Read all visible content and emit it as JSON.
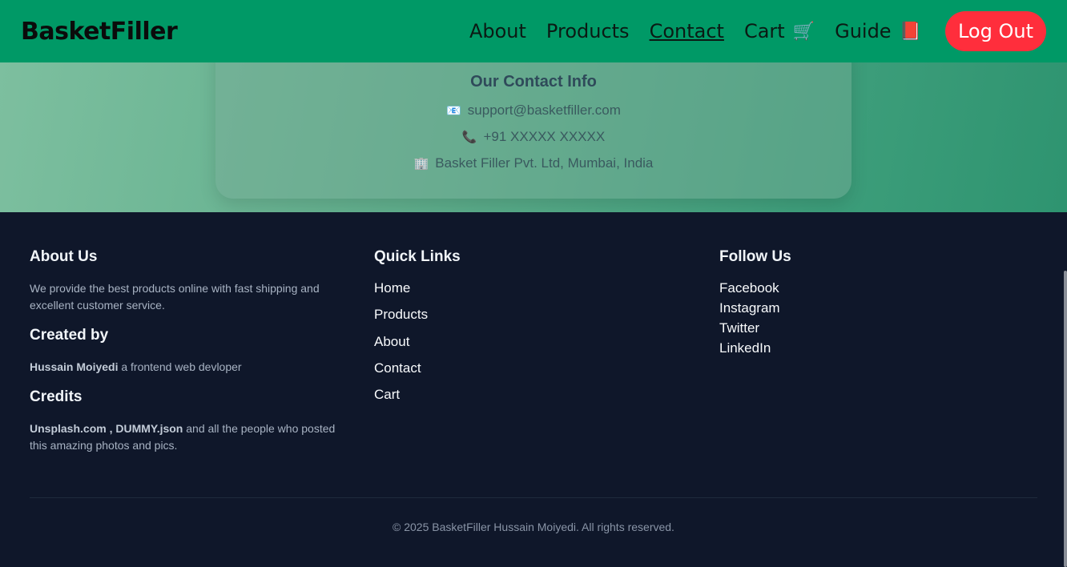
{
  "navbar": {
    "brand": "BasketFiller",
    "links": [
      {
        "label": "About",
        "icon": ""
      },
      {
        "label": "Products",
        "icon": ""
      },
      {
        "label": "Contact",
        "icon": "",
        "active": true
      },
      {
        "label": "Cart",
        "icon": "🛒"
      },
      {
        "label": "Guide",
        "icon": "📕"
      }
    ],
    "logout_label": "Log Out",
    "color": "#009966",
    "logout_color": "#ff2e3c"
  },
  "contact": {
    "title": "Our Contact Info",
    "email_icon": "📧",
    "email": "support@basketfiller.com",
    "phone_icon": "📞",
    "phone": "+91 XXXXX XXXXX",
    "address_icon": "🏢",
    "address": "Basket Filler Pvt. Ltd, Mumbai, India"
  },
  "footer": {
    "about": {
      "title": "About Us",
      "text": "We provide the best products online with fast shipping and excellent customer service."
    },
    "created_by": {
      "title": "Created by",
      "name": "Hussain Moiyedi",
      "text": " a frontend web devloper"
    },
    "credits": {
      "title": "Credits",
      "sources": "Unsplash.com , DUMMY.json",
      "text": " and all the people who posted this amazing photos and pics."
    },
    "quick_links": {
      "title": "Quick Links",
      "items": [
        "Home",
        "Products",
        "About",
        "Contact",
        "Cart"
      ]
    },
    "follow": {
      "title": "Follow Us",
      "items": [
        "Facebook",
        "Instagram",
        "Twitter",
        "LinkedIn"
      ]
    },
    "copyright": "© 2025 BasketFiller Hussain Moiyedi. All rights reserved.",
    "background": "#0f172a"
  }
}
